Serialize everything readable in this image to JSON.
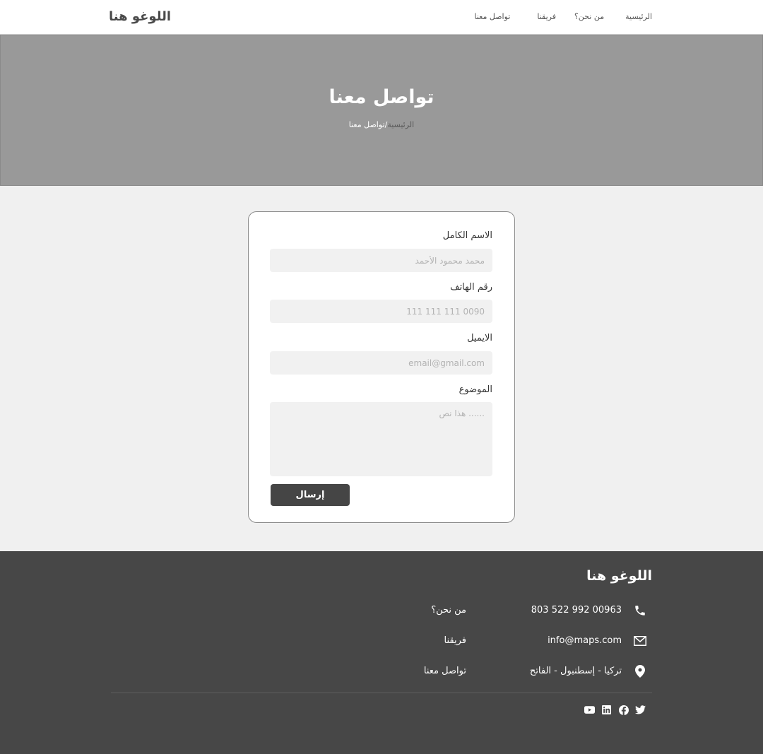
{
  "header": {
    "logo": "اللوغو هنا",
    "nav": [
      {
        "label": "الرئيسية"
      },
      {
        "label": "من نحن؟"
      },
      {
        "label": "فريقنا"
      },
      {
        "label": "تواصل معنا"
      }
    ]
  },
  "hero": {
    "title": "تواصل معنا",
    "breadcrumb_home": "الرئيسية",
    "breadcrumb_sep": "/",
    "breadcrumb_current": "تواصل معنا"
  },
  "form": {
    "name_label": "الاسم الكامل",
    "name_placeholder": "محمد محمود الأحمد",
    "phone_label": "رقم الهاتف",
    "phone_placeholder": "0090 111 111 111",
    "email_label": "الايميل",
    "email_placeholder": "email@gmail.com",
    "subject_label": "الموضوع",
    "subject_placeholder": "...... هذا نص",
    "submit_label": "إرسال"
  },
  "footer": {
    "logo": "اللوغو هنا",
    "phone": "00963 992 522 803",
    "email": "info@maps.com",
    "address": "تركيا - إسطنبول - الفاتح",
    "links": [
      {
        "label": "من نحن؟"
      },
      {
        "label": "فريقنا"
      },
      {
        "label": "تواصل معنا"
      }
    ],
    "socials": [
      "twitter-icon",
      "facebook-icon",
      "linkedin-icon",
      "youtube-icon"
    ]
  },
  "colors": {
    "hero_bg": "#999999",
    "footer_bg": "#474747",
    "button_bg": "#454545",
    "page_bg": "#f0f0f0"
  }
}
